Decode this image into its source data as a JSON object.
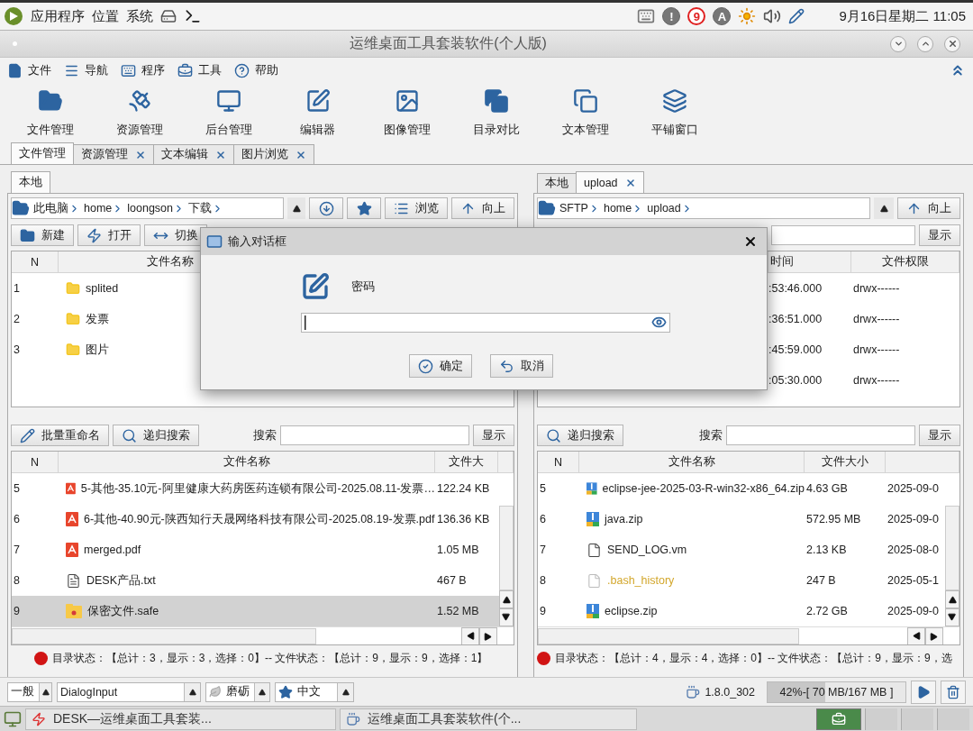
{
  "top_panel": {
    "menus": [
      "应用程序",
      "位置",
      "系统"
    ],
    "tray": [
      {
        "kind": "alert",
        "label": "!"
      },
      {
        "kind": "count",
        "label": "9"
      },
      {
        "kind": "letter",
        "label": "A"
      }
    ],
    "clock": "9月16日星期二 11:05"
  },
  "window": {
    "title": "运维桌面工具套装软件(个人版)"
  },
  "menu": [
    {
      "kind": "file",
      "label": "文件"
    },
    {
      "kind": "nav",
      "label": "导航"
    },
    {
      "kind": "program",
      "label": "程序"
    },
    {
      "kind": "tools",
      "label": "工具"
    },
    {
      "kind": "help",
      "label": "帮助"
    }
  ],
  "toolbar": [
    {
      "kind": "folder",
      "label": "文件管理"
    },
    {
      "kind": "resource",
      "label": "资源管理"
    },
    {
      "kind": "monitor",
      "label": "后台管理"
    },
    {
      "kind": "edit",
      "label": "编辑器"
    },
    {
      "kind": "image",
      "label": "图像管理"
    },
    {
      "kind": "compare",
      "label": "目录对比"
    },
    {
      "kind": "text",
      "label": "文本管理"
    },
    {
      "kind": "tile",
      "label": "平铺窗口"
    }
  ],
  "tabs": [
    {
      "label": "文件管理",
      "selected": true,
      "closable": false
    },
    {
      "label": "资源管理",
      "selected": false,
      "closable": true
    },
    {
      "label": "文本编辑",
      "selected": false,
      "closable": true
    },
    {
      "label": "图片浏览",
      "selected": false,
      "closable": true
    }
  ],
  "left_panel": {
    "tabs": [
      {
        "label": "本地",
        "selected": true,
        "closable": false
      }
    ],
    "path": [
      "此电脑",
      "home",
      "loongson",
      "下载"
    ],
    "buttons": [
      {
        "kind": "download"
      },
      {
        "kind": "star"
      },
      {
        "kind": "browse",
        "label": "浏览"
      },
      {
        "kind": "up",
        "label": "向上"
      }
    ],
    "actions": [
      {
        "kind": "new",
        "label": "新建"
      },
      {
        "kind": "open",
        "label": "打开"
      },
      {
        "kind": "switch",
        "label": "切换"
      }
    ],
    "dir_table": {
      "columns": [
        "N",
        "文件名称"
      ],
      "rows": [
        {
          "n": "1",
          "name": "splited"
        },
        {
          "n": "2",
          "name": "发票"
        },
        {
          "n": "3",
          "name": "图片"
        }
      ]
    },
    "file_toolbar": {
      "buttons": [
        {
          "kind": "rename",
          "label": "批量重命名"
        },
        {
          "kind": "search",
          "label": "递归搜索"
        }
      ],
      "search_label": "搜索",
      "show_button": "显示"
    },
    "file_table": {
      "columns": [
        "N",
        "文件名称",
        "文件大"
      ],
      "rows": [
        {
          "n": "5",
          "kind": "pdf",
          "name": "5-其他-35.10元-阿里健康大药房医药连锁有限公司-2025.08.11-发票…",
          "size": "122.24 KB",
          "selected": false
        },
        {
          "n": "6",
          "kind": "pdf",
          "name": "6-其他-40.90元-陕西知行天晟网络科技有限公司-2025.08.19-发票.pdf",
          "size": "136.36 KB",
          "selected": false
        },
        {
          "n": "7",
          "kind": "pdf",
          "name": "merged.pdf",
          "size": "1.05 MB",
          "selected": false
        },
        {
          "n": "8",
          "kind": "text",
          "name": "DESK产品.txt",
          "size": "467 B",
          "selected": false
        },
        {
          "n": "9",
          "kind": "safe",
          "name": "保密文件.safe",
          "size": "1.52 MB",
          "selected": true
        }
      ]
    },
    "status": "目录状态：【总计：3，显示：3，选择：0】-- 文件状态：【总计：9，显示：9，选择：1】"
  },
  "right_panel": {
    "tabs": [
      {
        "label": "本地",
        "selected": false,
        "closable": false
      },
      {
        "label": "upload",
        "selected": true,
        "closable": true
      }
    ],
    "path": [
      "SFTP",
      "home",
      "upload"
    ],
    "buttons": [
      {
        "kind": "up",
        "label": "向上"
      }
    ],
    "show_button": "显示",
    "dir_table": {
      "columns": [
        "时间",
        "文件权限"
      ],
      "rows": [
        {
          "time": ":53:46.000",
          "permissions": "drwx------"
        },
        {
          "time": ":36:51.000",
          "permissions": "drwx------"
        },
        {
          "time": ":45:59.000",
          "permissions": "drwx------"
        },
        {
          "time": ":05:30.000",
          "permissions": "drwx------"
        }
      ]
    },
    "file_toolbar": {
      "buttons": [
        {
          "kind": "search",
          "label": "递归搜索"
        }
      ],
      "search_label": "搜索",
      "show_button": "显示"
    },
    "file_table": {
      "columns": [
        "N",
        "文件名称",
        "文件大小"
      ],
      "rows": [
        {
          "n": "5",
          "kind": "zip",
          "name": "eclipse-jee-2025-03-R-win32-x86_64.zip",
          "size": "4.63 GB",
          "date": "2025-09-0",
          "selected": false
        },
        {
          "n": "6",
          "kind": "zip",
          "name": "java.zip",
          "size": "572.95 MB",
          "date": "2025-09-0",
          "selected": false
        },
        {
          "n": "7",
          "kind": "file",
          "name": "SEND_LOG.vm",
          "size": "2.13 KB",
          "date": "2025-08-0",
          "selected": false
        },
        {
          "n": "8",
          "kind": "hidden",
          "name": ".bash_history",
          "size": "247 B",
          "date": "2025-05-1",
          "selected": false
        },
        {
          "n": "9",
          "kind": "zip",
          "name": "eclipse.zip",
          "size": "2.72 GB",
          "date": "2025-09-0",
          "selected": false
        }
      ]
    },
    "status": "目录状态：【总计：4，显示：4，选择：0】-- 文件状态：【总计：9，显示：9，选"
  },
  "dialog": {
    "title": "输入对话框",
    "label": "密码",
    "buttons": [
      {
        "kind": "ok",
        "label": "确定"
      },
      {
        "kind": "cancel",
        "label": "取消"
      }
    ]
  },
  "bottom_bar": {
    "combos": [
      {
        "kind": "plain",
        "value": "一般"
      },
      {
        "kind": "font",
        "value": "DialogInput"
      },
      {
        "kind": "theme",
        "value": "磨砺"
      },
      {
        "kind": "language",
        "value": "中文"
      }
    ],
    "java_version": "1.8.0_302",
    "memory": {
      "label": "42%-[ 70 MB/167 MB ]",
      "level": 0.42
    }
  },
  "taskbar": {
    "tasks": [
      {
        "kind": "desk",
        "label": "DESK—运维桌面工具套装..."
      },
      {
        "kind": "java",
        "label": "运维桌面工具套装软件(个..."
      }
    ]
  }
}
